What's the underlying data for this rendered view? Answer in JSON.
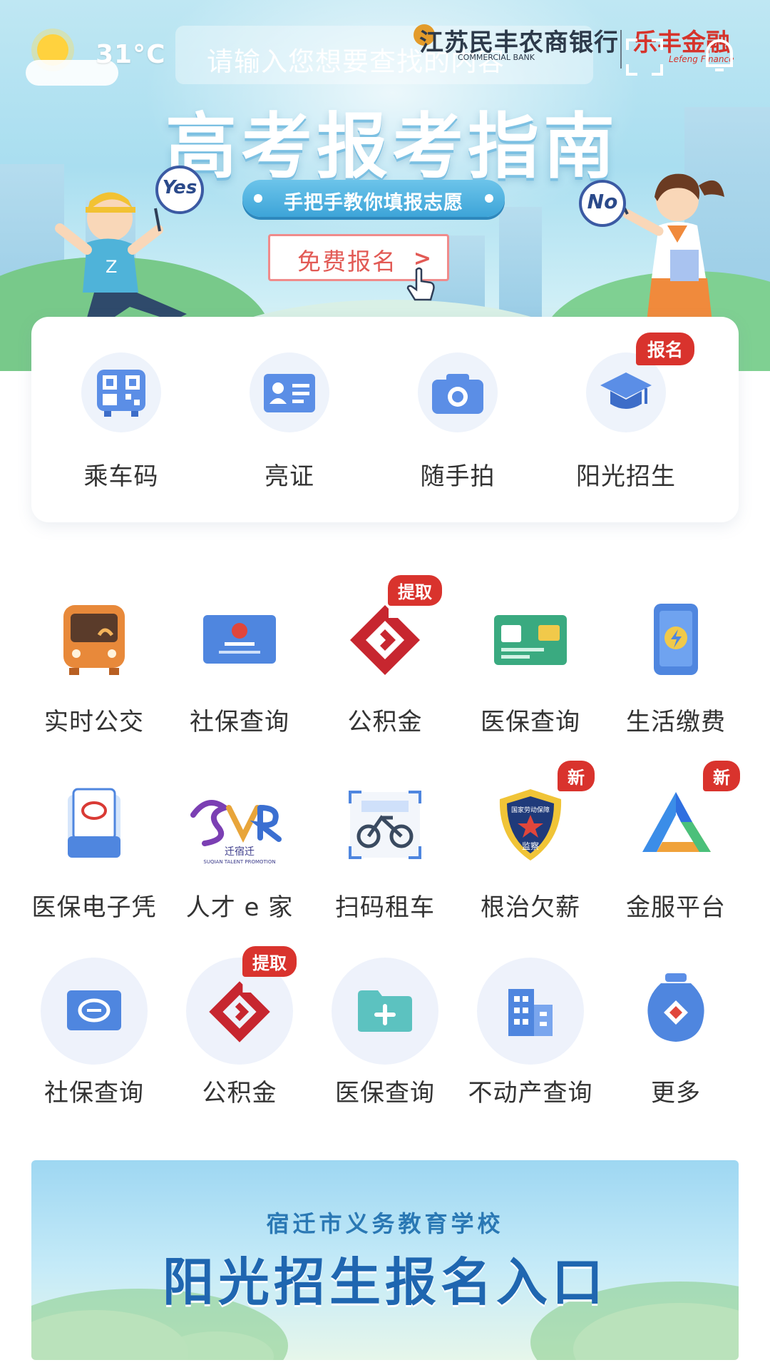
{
  "header": {
    "temperature": "31°C",
    "search_placeholder": "请输入您想要查找的内容",
    "bank_name": "江苏民丰农商银行",
    "bank_name_en": "COMMERCIAL BANK",
    "brand_name": "乐丰金融",
    "brand_name_en": "Lefeng Finance"
  },
  "hero": {
    "title": "高考报考指南",
    "subtitle": "手把手教你填报志愿",
    "cta": "免费报名",
    "yes_sign": "Yes",
    "no_sign": "No"
  },
  "shortcuts": [
    {
      "label": "乘车码",
      "icon": "qr-bus-icon"
    },
    {
      "label": "亮证",
      "icon": "id-card-icon"
    },
    {
      "label": "随手拍",
      "icon": "camera-icon"
    },
    {
      "label": "阳光招生",
      "icon": "graduation-cap-icon",
      "badge": "报名"
    }
  ],
  "services": [
    {
      "label": "实时公交",
      "icon": "bus-icon"
    },
    {
      "label": "社保查询",
      "icon": "social-security-card-icon"
    },
    {
      "label": "公积金",
      "icon": "housing-fund-icon",
      "badge": "提取"
    },
    {
      "label": "医保查询",
      "icon": "medical-card-icon"
    },
    {
      "label": "生活缴费",
      "icon": "phone-bill-icon"
    },
    {
      "label": "医保电子凭",
      "icon": "medical-voucher-icon"
    },
    {
      "label": "人才 e 家",
      "icon": "talent-logo-icon"
    },
    {
      "label": "扫码租车",
      "icon": "bike-scan-icon"
    },
    {
      "label": "根治欠薪",
      "icon": "wage-supervision-badge-icon",
      "badge": "新"
    },
    {
      "label": "金服平台",
      "icon": "finance-platform-icon",
      "badge": "新"
    },
    {
      "label": "社保查询",
      "icon": "si-circle-icon"
    },
    {
      "label": "公积金",
      "icon": "housing-fund-circle-icon",
      "badge": "提取"
    },
    {
      "label": "医保查询",
      "icon": "folder-plus-icon"
    },
    {
      "label": "不动产查询",
      "icon": "building-icon"
    },
    {
      "label": "更多",
      "icon": "more-jar-icon"
    }
  ],
  "talent_logo_text": "迁宿迁",
  "talent_logo_en": "SUQIAN TALENT PROMOTION",
  "wage_badge_text": "国家劳动保障",
  "wage_badge_main": "监察",
  "promo": {
    "subtitle": "宿迁市义务教育学校",
    "title": "阳光招生报名入口"
  },
  "colors": {
    "accent_red": "#d9332d",
    "brand_blue": "#1f66b0"
  }
}
